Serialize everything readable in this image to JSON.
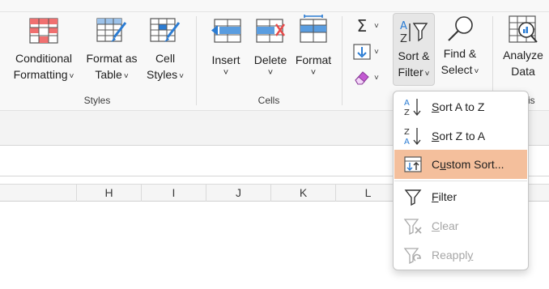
{
  "ribbon": {
    "styles_group": {
      "label": "Styles",
      "conditional_formatting": {
        "line1": "Conditional",
        "line2": "Formatting"
      },
      "format_as_table": {
        "line1": "Format as",
        "line2": "Table"
      },
      "cell_styles": {
        "line1": "Cell",
        "line2": "Styles"
      }
    },
    "cells_group": {
      "label": "Cells",
      "insert": "Insert",
      "delete": "Delete",
      "format": "Format"
    },
    "editing_group": {
      "autosum_icon": "sigma-icon",
      "fill_icon": "fill-down-icon",
      "clear_icon": "eraser-icon",
      "sort_filter": {
        "line1": "Sort &",
        "line2": "Filter"
      },
      "find_select": {
        "line1": "Find &",
        "line2": "Select"
      }
    },
    "analysis_group": {
      "label_fragment": "sis",
      "analyze_data": {
        "line1": "Analyze",
        "line2": "Data"
      }
    },
    "chevron": "˅"
  },
  "columns": [
    "H",
    "I",
    "J",
    "K",
    "L"
  ],
  "sort_menu": {
    "items": [
      {
        "prefix": "",
        "key": "S",
        "rest": "ort A to Z",
        "icon": "sort-a-to-z-icon",
        "disabled": false
      },
      {
        "prefix": "",
        "key": "S",
        "rest": "ort Z to A",
        "icon": "sort-z-to-a-icon",
        "disabled": false
      },
      {
        "prefix": "C",
        "key": "u",
        "rest": "stom Sort...",
        "icon": "custom-sort-icon",
        "disabled": false,
        "highlighted": true
      },
      {
        "prefix": "",
        "key": "F",
        "rest": "ilter",
        "icon": "filter-icon",
        "disabled": false
      },
      {
        "prefix": "",
        "key": "C",
        "rest": "lear",
        "icon": "clear-filter-icon",
        "disabled": true
      },
      {
        "prefix": "Reappl",
        "key": "y",
        "rest": "",
        "icon": "reapply-filter-icon",
        "disabled": true
      }
    ]
  },
  "colors": {
    "highlight": "#f4bf9c",
    "accent_blue": "#2b7cd3",
    "accent_red": "#e84a4a",
    "disabled_text": "#a6a6a6"
  }
}
